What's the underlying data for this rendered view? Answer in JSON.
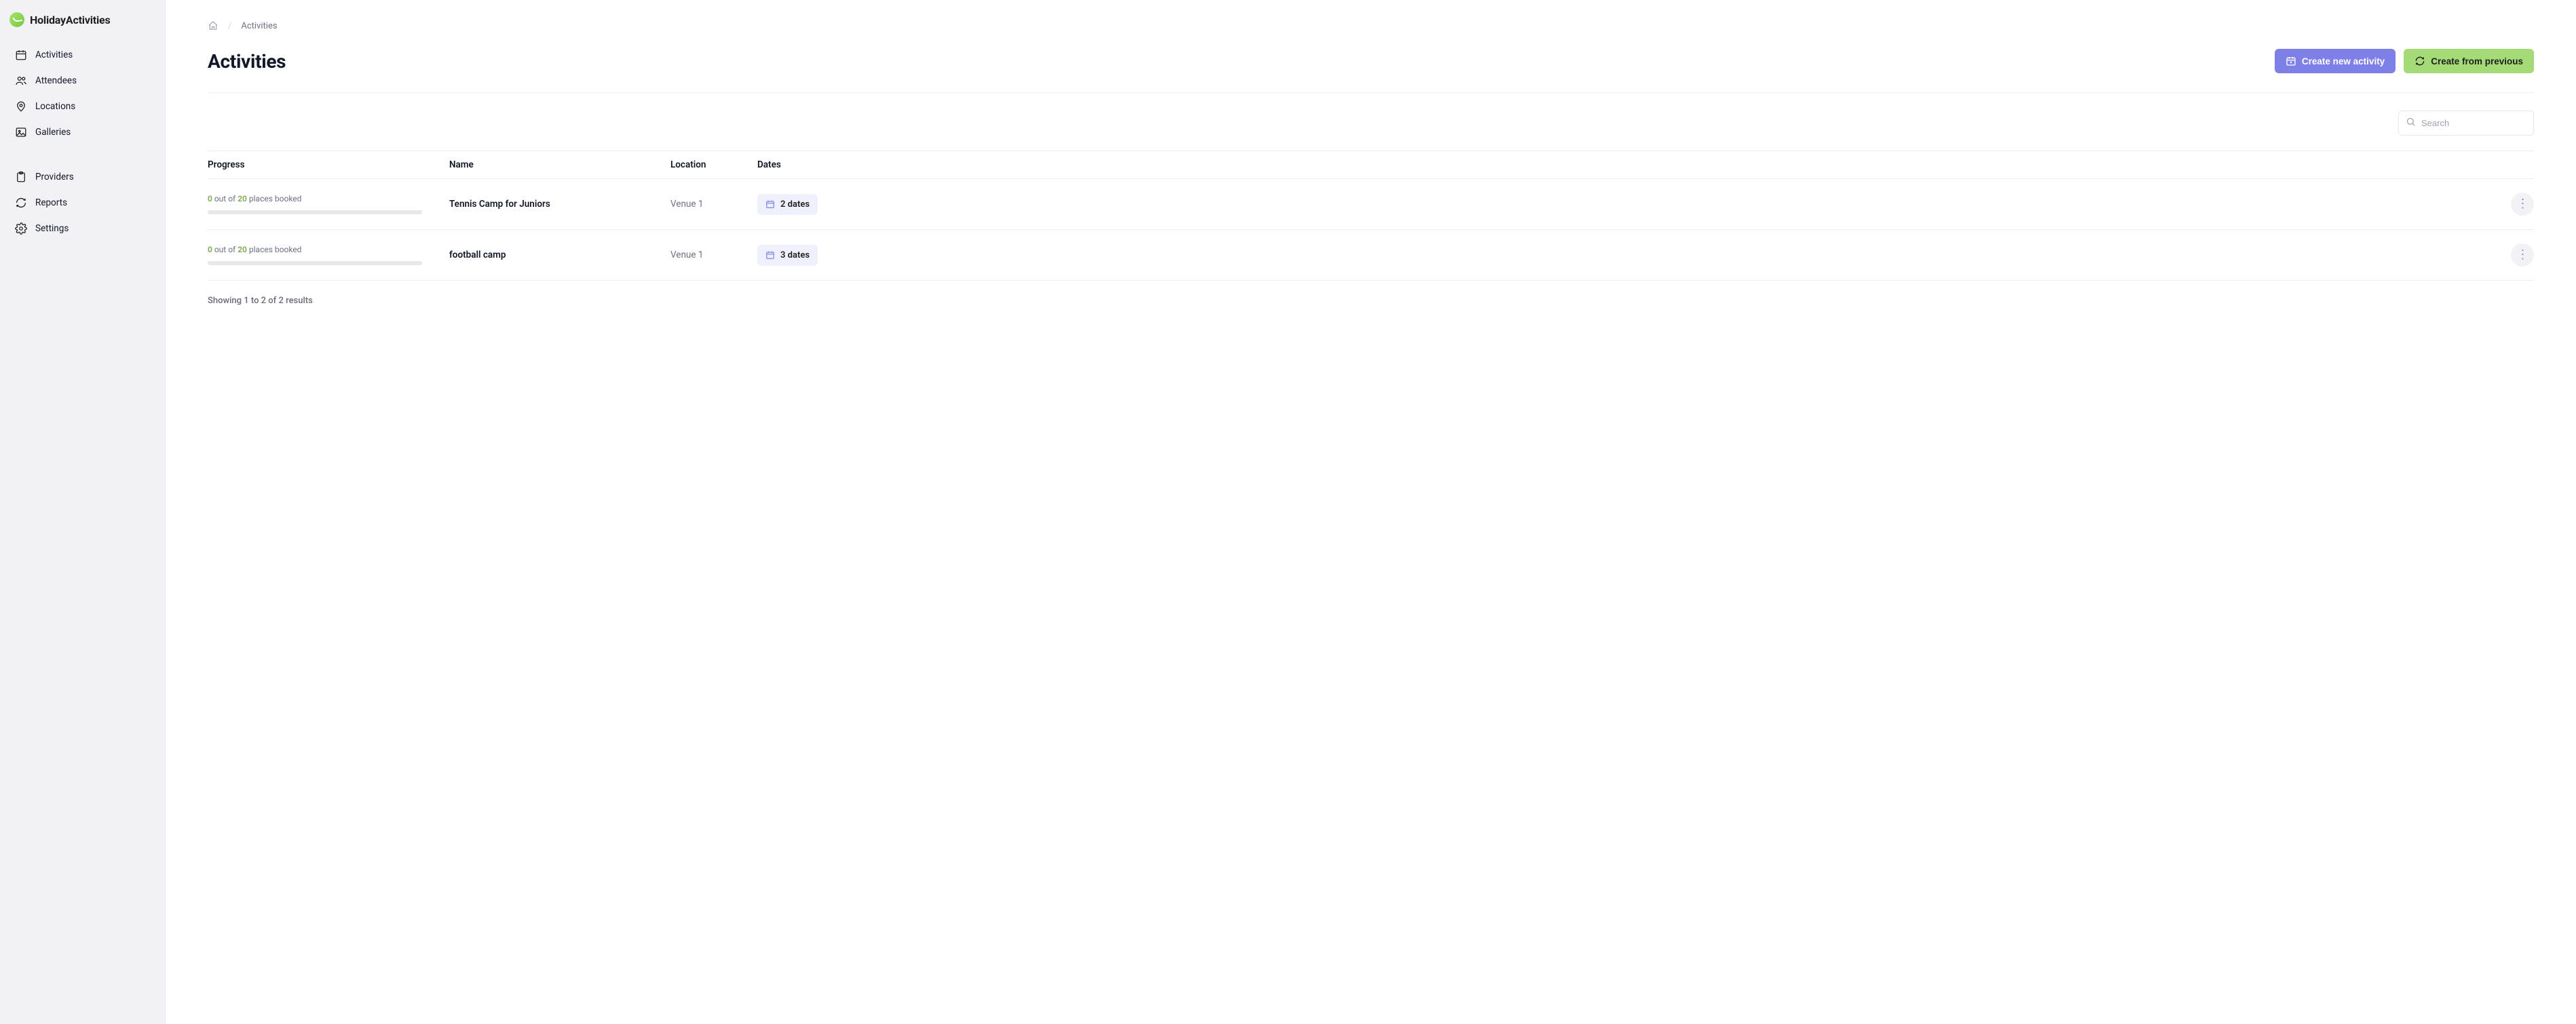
{
  "brand": {
    "name": "HolidayActivities"
  },
  "sidebar": {
    "group1": [
      {
        "icon": "calendar-icon",
        "label": "Activities"
      },
      {
        "icon": "users-icon",
        "label": "Attendees"
      },
      {
        "icon": "location-pin-icon",
        "label": "Locations"
      },
      {
        "icon": "image-icon",
        "label": "Galleries"
      }
    ],
    "group2": [
      {
        "icon": "clipboard-icon",
        "label": "Providers"
      },
      {
        "icon": "refresh-icon",
        "label": "Reports"
      },
      {
        "icon": "gear-icon",
        "label": "Settings"
      }
    ]
  },
  "breadcrumb": {
    "current": "Activities"
  },
  "page": {
    "title": "Activities"
  },
  "actions": {
    "create_new": "Create new activity",
    "create_previous": "Create from previous"
  },
  "search": {
    "placeholder": "Search",
    "value": ""
  },
  "table": {
    "headers": {
      "progress": "Progress",
      "name": "Name",
      "location": "Location",
      "dates": "Dates"
    },
    "rows": [
      {
        "progress": {
          "booked": "0",
          "between": " out of ",
          "capacity": "20",
          "suffix": " places booked"
        },
        "name": "Tennis Camp for Juniors",
        "location": "Venue 1",
        "dates_label": "2 dates"
      },
      {
        "progress": {
          "booked": "0",
          "between": " out of ",
          "capacity": "20",
          "suffix": " places booked"
        },
        "name": "football camp",
        "location": "Venue 1",
        "dates_label": "3 dates"
      }
    ]
  },
  "results_line": "Showing 1 to 2 of 2 results",
  "colors": {
    "accent_primary": "#7e80e8",
    "accent_secondary": "#a5db77",
    "highlight_green": "#7aa852"
  }
}
